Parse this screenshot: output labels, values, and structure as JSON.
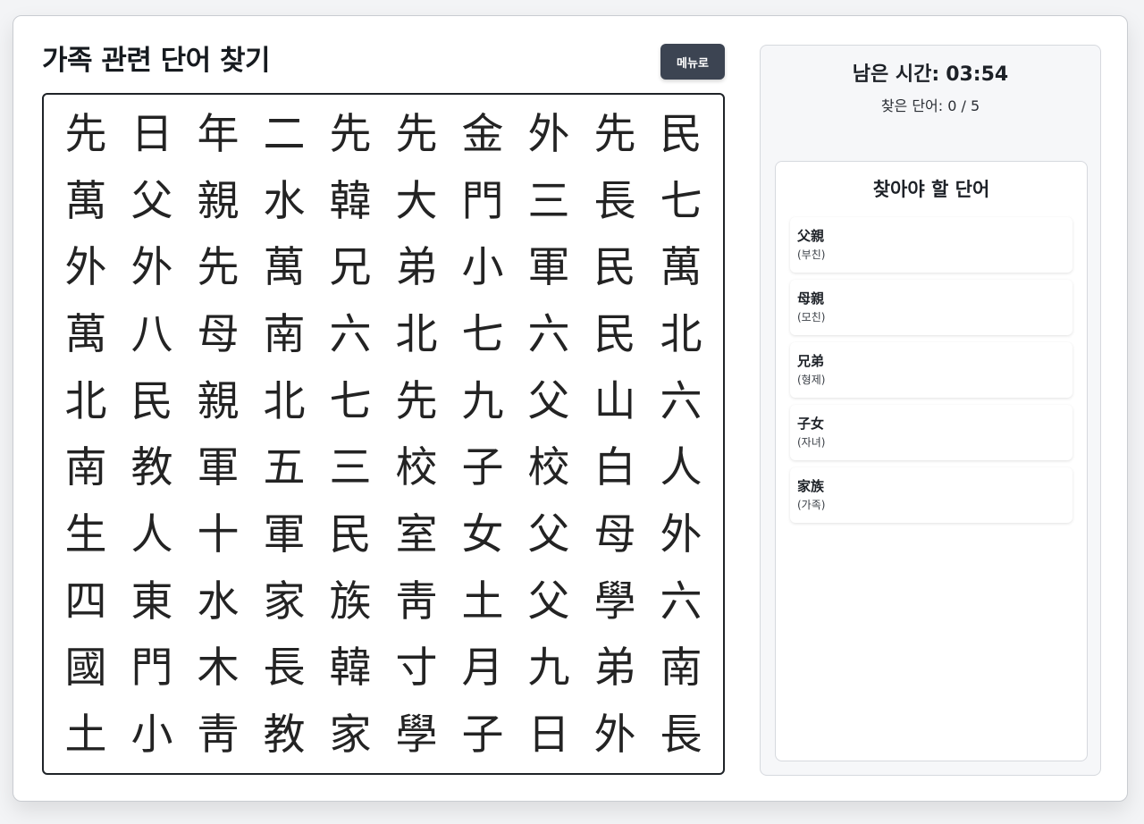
{
  "title": "가족 관련 단어 찾기",
  "menu_label": "메뉴로",
  "timer": {
    "label": "남은 시간:",
    "value": "03:54"
  },
  "progress": {
    "text": "찾은 단어: 0 / 5",
    "found": 0,
    "total": 5
  },
  "word_panel_title": "찾아야 할 단어",
  "words": [
    {
      "hanja": "父親",
      "reading": "(부친)"
    },
    {
      "hanja": "母親",
      "reading": "(모친)"
    },
    {
      "hanja": "兄弟",
      "reading": "(형제)"
    },
    {
      "hanja": "子女",
      "reading": "(자녀)"
    },
    {
      "hanja": "家族",
      "reading": "(가족)"
    }
  ],
  "grid": [
    [
      "先",
      "日",
      "年",
      "二",
      "先",
      "先",
      "金",
      "外",
      "先",
      "民"
    ],
    [
      "萬",
      "父",
      "親",
      "水",
      "韓",
      "大",
      "門",
      "三",
      "長",
      "七"
    ],
    [
      "外",
      "外",
      "先",
      "萬",
      "兄",
      "弟",
      "小",
      "軍",
      "民",
      "萬"
    ],
    [
      "萬",
      "八",
      "母",
      "南",
      "六",
      "北",
      "七",
      "六",
      "民",
      "北"
    ],
    [
      "北",
      "民",
      "親",
      "北",
      "七",
      "先",
      "九",
      "父",
      "山",
      "六"
    ],
    [
      "南",
      "教",
      "軍",
      "五",
      "三",
      "校",
      "子",
      "校",
      "白",
      "人"
    ],
    [
      "生",
      "人",
      "十",
      "軍",
      "民",
      "室",
      "女",
      "父",
      "母",
      "外"
    ],
    [
      "四",
      "東",
      "水",
      "家",
      "族",
      "靑",
      "土",
      "父",
      "學",
      "六"
    ],
    [
      "國",
      "門",
      "木",
      "長",
      "韓",
      "寸",
      "月",
      "九",
      "弟",
      "南"
    ],
    [
      "土",
      "小",
      "靑",
      "教",
      "家",
      "學",
      "子",
      "日",
      "外",
      "長"
    ]
  ]
}
